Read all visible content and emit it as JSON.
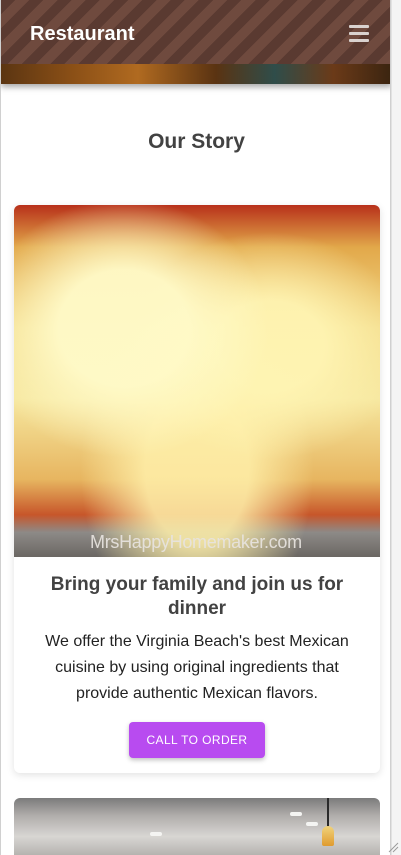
{
  "header": {
    "brand": "Restaurant",
    "menu_icon": "hamburger-menu-icon"
  },
  "section": {
    "title": "Our Story"
  },
  "card": {
    "image_watermark": "MrsHappyHomemaker.com",
    "title": "Bring your family and join us for dinner",
    "text": "We offer the Virginia Beach's best Mexican cuisine by using original ingredients that provide authentic Mexican flavors.",
    "button_label": "CALL TO ORDER"
  },
  "colors": {
    "accent": "#b84bf0",
    "header_stripe_dark": "#5a3a31",
    "header_stripe_light": "#6f4a3e",
    "heading_text": "#424242"
  }
}
